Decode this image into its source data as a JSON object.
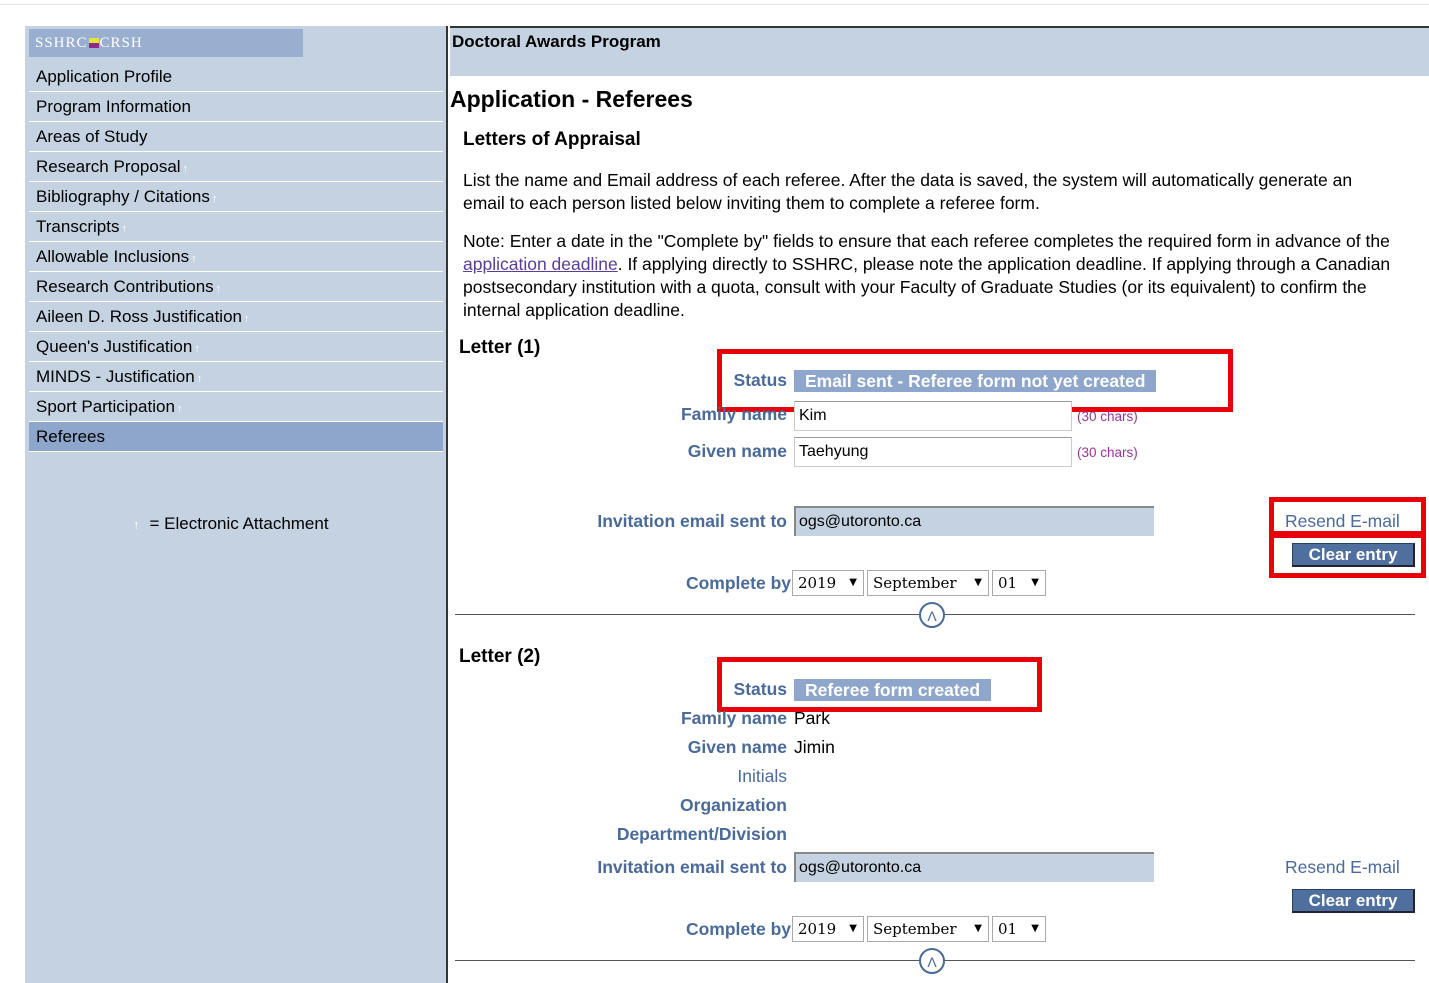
{
  "logo": {
    "left": "SSHRC",
    "right": "CRSH"
  },
  "sidebar": {
    "items": [
      {
        "label": "Application Profile",
        "attachment": false
      },
      {
        "label": "Program Information",
        "attachment": false
      },
      {
        "label": "Areas of Study",
        "attachment": false
      },
      {
        "label": "Research Proposal",
        "attachment": true
      },
      {
        "label": "Bibliography / Citations",
        "attachment": true
      },
      {
        "label": "Transcripts",
        "attachment": true
      },
      {
        "label": "Allowable Inclusions",
        "attachment": true
      },
      {
        "label": "Research Contributions",
        "attachment": true
      },
      {
        "label": "Aileen D. Ross Justification",
        "attachment": true
      },
      {
        "label": "Queen's Justification",
        "attachment": true
      },
      {
        "label": "MINDS - Justification",
        "attachment": true
      },
      {
        "label": "Sport Participation",
        "attachment": true
      },
      {
        "label": "Referees",
        "attachment": false,
        "active": true
      }
    ],
    "legend": "= Electronic Attachment",
    "attachment_icon": "up-arrow-icon"
  },
  "header": {
    "program": "Doctoral Awards Program"
  },
  "page": {
    "title": "Application - Referees",
    "section": "Letters of Appraisal",
    "para1": "List the name and Email address of each referee. After the data is saved, the system will automatically generate an email to each person listed below inviting them to complete a referee form.",
    "note_before": "Note: Enter a date in the \"Complete by\" fields to ensure that each referee completes the required form in advance of the ",
    "note_link": "application deadline",
    "note_after": ". If applying directly to SSHRC, please note the application deadline. If applying through a Canadian postsecondary institution with a quota, consult with your Faculty of Graduate Studies (or its equivalent) to confirm the internal application deadline."
  },
  "labels": {
    "status": "Status",
    "family_name": "Family name",
    "given_name": "Given name",
    "initials": "Initials",
    "organization": "Organization",
    "department": "Department/Division",
    "invitation": "Invitation email sent to",
    "complete_by": "Complete by",
    "chars": "(30 chars)",
    "resend": "Resend E-mail",
    "clear": "Clear entry",
    "up_glyph": "Λ"
  },
  "letters": [
    {
      "title": "Letter  (1)",
      "status": "Email sent - Referee form not yet created",
      "family_name": "Kim",
      "given_name": "Taehyung",
      "email": "ogs@utoronto.ca",
      "year": "2019",
      "month": "September",
      "day": "01"
    },
    {
      "title": "Letter  (2)",
      "status": "Referee form created",
      "family_name": "Park",
      "given_name": "Jimin",
      "email": "ogs@utoronto.ca",
      "year": "2019",
      "month": "September",
      "day": "01"
    }
  ],
  "colors": {
    "highlight": "#e8000b",
    "panel": "#c5d2e1",
    "label": "#4a6a9a"
  }
}
